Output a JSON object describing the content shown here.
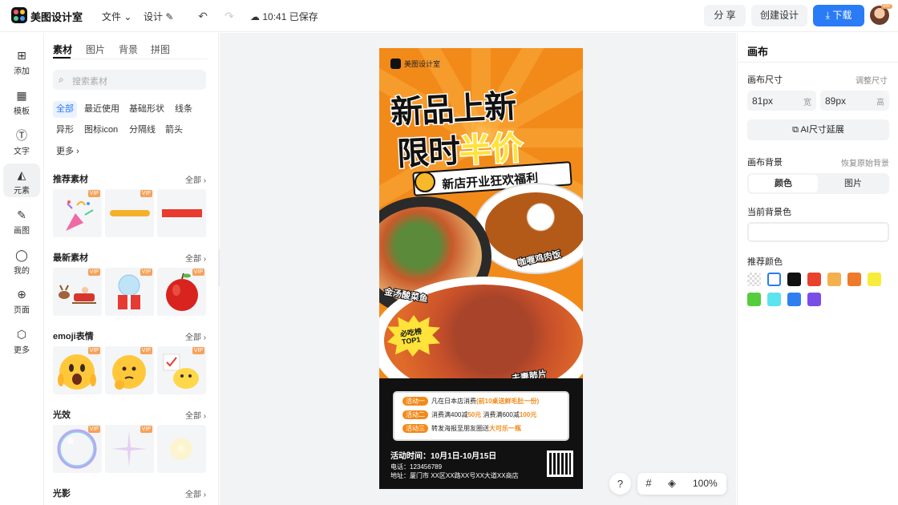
{
  "topbar": {
    "app_title": "美图设计室",
    "menu_file": "文件",
    "menu_design": "设计",
    "save_status": "10:41 已保存",
    "share": "分 享",
    "create_design": "创建设计",
    "download": "下载",
    "avatar_badge": "VIP"
  },
  "leftnav": {
    "items": [
      {
        "label": "添加",
        "icon": "plus-square-icon"
      },
      {
        "label": "模板",
        "icon": "template-icon"
      },
      {
        "label": "文字",
        "icon": "text-icon"
      },
      {
        "label": "元素",
        "icon": "shapes-icon"
      },
      {
        "label": "画图",
        "icon": "draw-icon"
      },
      {
        "label": "我的",
        "icon": "user-icon"
      },
      {
        "label": "页面",
        "icon": "page-icon"
      },
      {
        "label": "更多",
        "icon": "cube-icon"
      }
    ],
    "active": "元素"
  },
  "panel": {
    "tabs": [
      "素材",
      "图片",
      "背景",
      "拼图"
    ],
    "search_placeholder": "搜索素材",
    "chips": [
      "全部",
      "最近使用",
      "基础形状",
      "线条",
      "异形",
      "图标icon",
      "分隔线",
      "箭头",
      "更多"
    ],
    "all_label": "全部",
    "vip": "VIP",
    "sections": [
      "推荐素材",
      "最新素材",
      "emoji表情",
      "光效",
      "光影"
    ]
  },
  "canvas": {
    "poster": {
      "brand": "美图设计室",
      "title_line1": "新品上新",
      "title_line2_a": "限时",
      "title_line2_b": "半价",
      "banner": "新店开业狂欢福利",
      "dish1": "咖喱鸡肉饭",
      "dish2": "金汤酸菜鱼",
      "dish3": "夫妻肺片",
      "burst_line1": "必吃榜",
      "burst_line2": "TOP1",
      "act1_tag": "活动一",
      "act1_text": "凡在日本店消费",
      "act1_hl": "(前10桌送鲜毛肚一份)",
      "act2_tag": "活动二",
      "act2_text_a": "消费满400减",
      "act2_hl_a": "50元",
      "act2_text_b": " 消费满600减",
      "act2_hl_b": "100元",
      "act3_tag": "活动三",
      "act3_text": "转发海报至朋友圈送",
      "act3_hl": "大可乐一瓶",
      "time": "活动时间：10月1日-10月15日",
      "phone": "电话：123456789",
      "address": "地址：厦门市 XX区XX路XX号XX大道XX商店"
    },
    "zoom": "100%",
    "help": "?"
  },
  "rpanel": {
    "title": "画布",
    "size_label": "画布尺寸",
    "adjust_size": "调整尺寸",
    "width_value": "81px",
    "width_unit": "宽",
    "height_value": "89px",
    "height_unit": "高",
    "ai_extend": "AI尺寸延展",
    "bg_label": "画布背景",
    "restore_bg": "恢复原始背景",
    "seg_color": "颜色",
    "seg_image": "图片",
    "current_bg": "当前背景色",
    "recommended": "推荐颜色",
    "swatches": [
      "transparent",
      "#ffffff",
      "#111111",
      "#e8412c",
      "#f3b04d",
      "#ee7a2a",
      "#f7ec3b",
      "#55cc3c",
      "#5be3f0",
      "#2f7ff1",
      "#7a4de8"
    ]
  }
}
